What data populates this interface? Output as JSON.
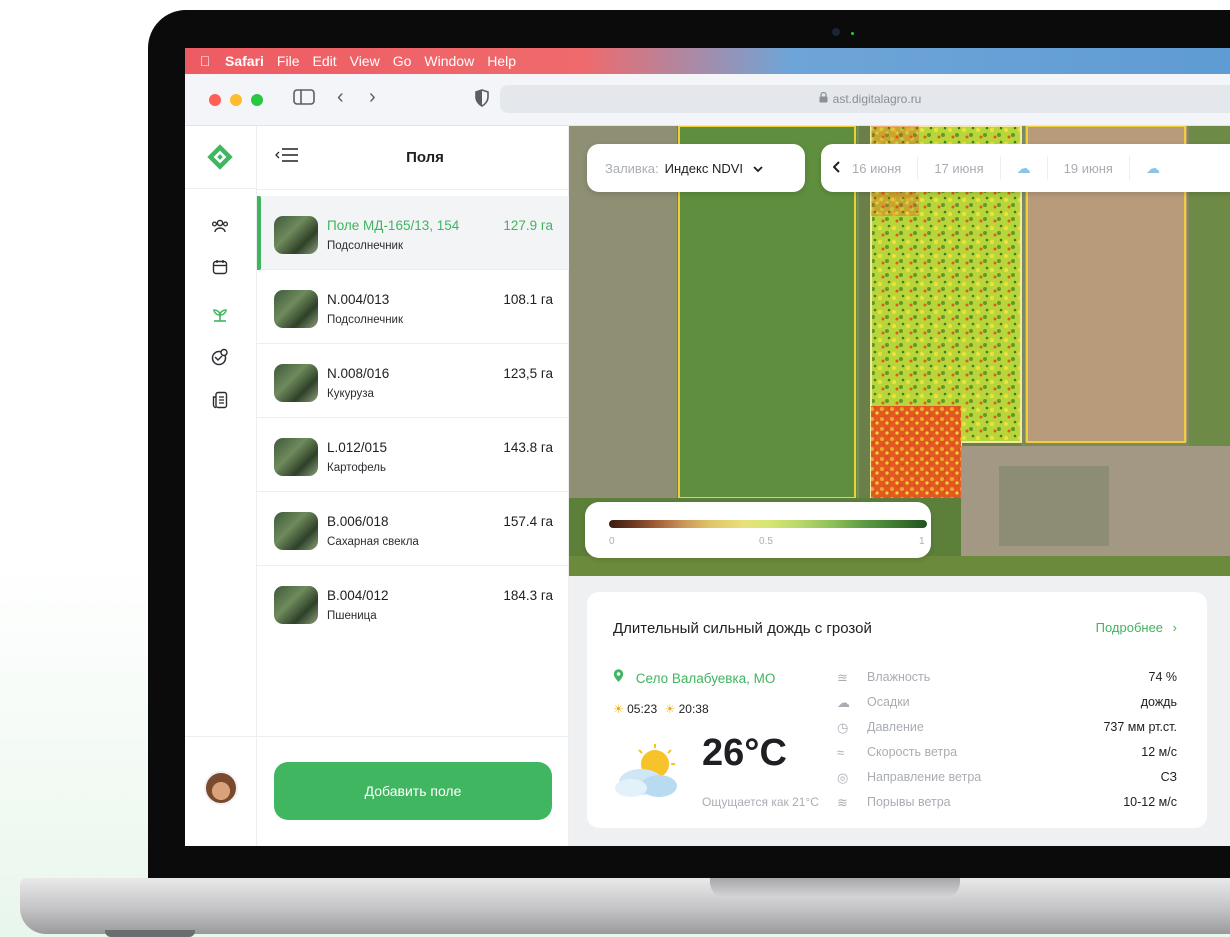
{
  "menubar": {
    "app": "Safari",
    "items": [
      "File",
      "Edit",
      "View",
      "Go",
      "Window",
      "Help"
    ]
  },
  "browser": {
    "url": "ast.digitalagro.ru"
  },
  "panel": {
    "title": "Поля",
    "add_button": "Добавить поле",
    "fields": [
      {
        "name": "Поле МД-165/13, 154",
        "crop": "Подсолнечник",
        "area": "127.9 га",
        "active": true
      },
      {
        "name": "N.004/013",
        "crop": "Подсолнечник",
        "area": "108.1 га"
      },
      {
        "name": "N.008/016",
        "crop": "Кукуруза",
        "area": "123,5 га"
      },
      {
        "name": "L.012/015",
        "crop": "Картофель",
        "area": "143.8 га"
      },
      {
        "name": "B.006/018",
        "crop": "Сахарная свекла",
        "area": "157.4 га"
      },
      {
        "name": "B.004/012",
        "crop": "Пшеница",
        "area": "184.3 га"
      }
    ]
  },
  "map": {
    "fill_label": "Заливка:",
    "fill_value": "Индекс NDVI",
    "dates": [
      "16 июня",
      "17 июня",
      "19 июня"
    ],
    "legend": {
      "min": "0",
      "mid": "0.5",
      "max": "1"
    }
  },
  "weather": {
    "headline": "Длительный сильный дождь с грозой",
    "more": "Подробнее",
    "location": "Село Валабуевка, МО",
    "sunrise": "05:23",
    "sunset": "20:38",
    "temperature": "26°C",
    "feels_like": "Ощущается как 21°C",
    "details": [
      {
        "label": "Влажность",
        "value": "74 %",
        "icon": "humidity-icon"
      },
      {
        "label": "Осадки",
        "value": "дождь",
        "icon": "precipitation-icon"
      },
      {
        "label": "Давление",
        "value": "737 мм рт.ст.",
        "icon": "pressure-icon"
      },
      {
        "label": "Скорость ветра",
        "value": "12 м/с",
        "icon": "wind-speed-icon"
      },
      {
        "label": "Направление ветра",
        "value": "СЗ",
        "icon": "wind-direction-icon"
      },
      {
        "label": "Порывы ветра",
        "value": "10-12 м/с",
        "icon": "wind-gust-icon"
      }
    ]
  },
  "colors": {
    "accent": "#41b661",
    "menubar_left": "#ee5c63",
    "menubar_right": "#5f9bd4"
  }
}
